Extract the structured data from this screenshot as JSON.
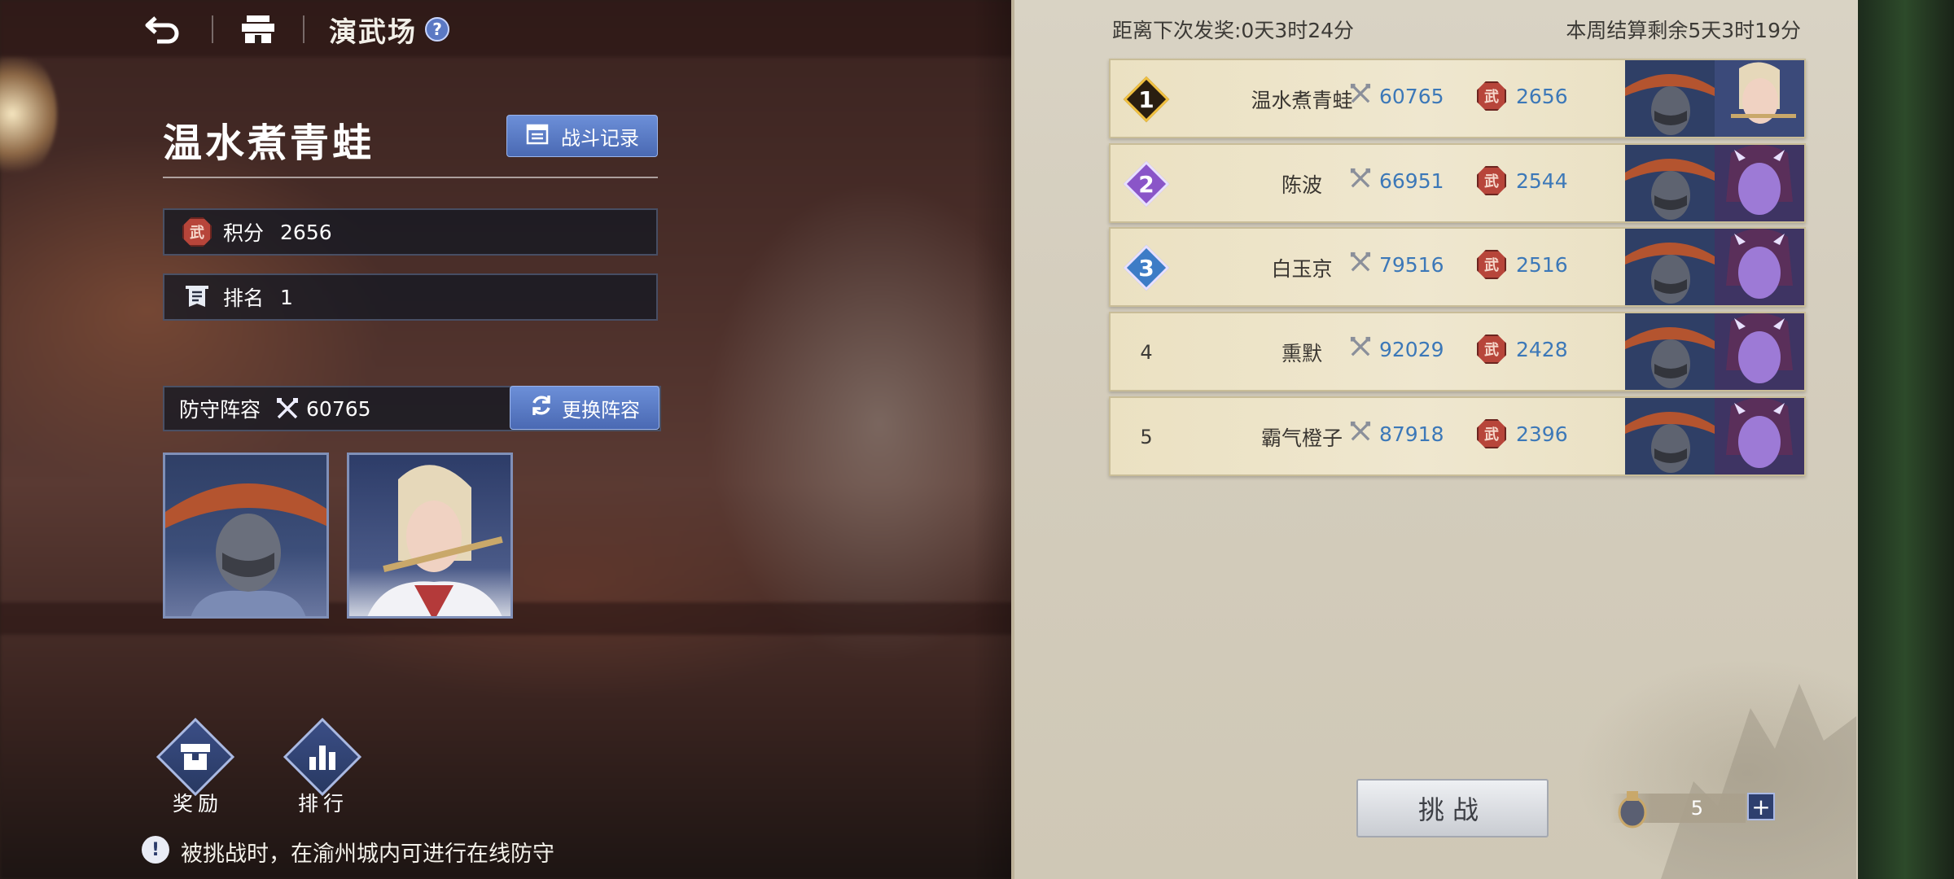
{
  "header": {
    "title": "演武场",
    "help": "?"
  },
  "player": {
    "name": "温水煮青蛙",
    "record_button": "战斗记录",
    "score_label": "积分",
    "score_value": "2656",
    "rank_label": "排名",
    "rank_value": "1",
    "score_badge": "武"
  },
  "defense": {
    "label": "防守阵容",
    "power": "60765",
    "change_button": "更换阵容"
  },
  "bottom_buttons": {
    "reward": "奖励",
    "ranking": "排行"
  },
  "tip": {
    "icon": "!",
    "text": "被挑战时，在渝州城内可进行在线防守"
  },
  "countdown": {
    "next_reward": "距离下次发奖:0天3时24分",
    "week_settle": "本周结算剩余5天3时19分"
  },
  "rankings": [
    {
      "rank": "1",
      "name": "温水煮青蛙",
      "power": "60765",
      "score": "2656",
      "rank_color": "#f0c040"
    },
    {
      "rank": "2",
      "name": "陈波",
      "power": "66951",
      "score": "2544",
      "rank_color": "#8a55c8"
    },
    {
      "rank": "3",
      "name": "白玉京",
      "power": "79516",
      "score": "2516",
      "rank_color": "#3d7cc6"
    },
    {
      "rank": "4",
      "name": "熏默",
      "power": "92029",
      "score": "2428",
      "rank_color": ""
    },
    {
      "rank": "5",
      "name": "霸气橙子",
      "power": "87918",
      "score": "2396",
      "rank_color": ""
    }
  ],
  "challenge": {
    "label": "挑战",
    "tickets": "5",
    "plus": "+"
  },
  "colors": {
    "accent_blue": "#4a69b3",
    "value_blue": "#3c78b8",
    "badge_red": "#b7453a"
  }
}
